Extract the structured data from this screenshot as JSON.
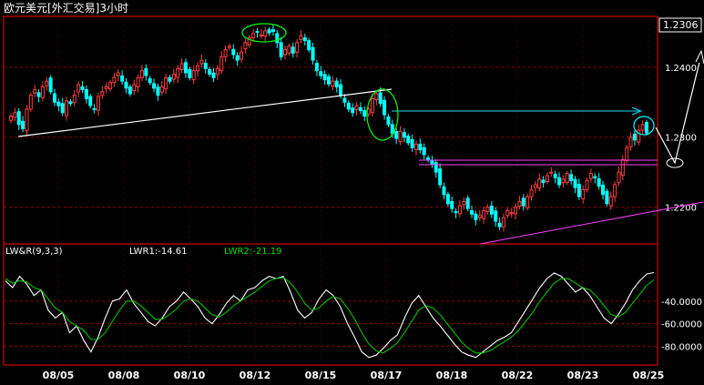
{
  "chart_title": "欧元美元[外汇交易]3小时",
  "price_box": "1.2306",
  "indicator": {
    "name": "LW&R(9,3,3)",
    "lwr1_label": "LWR1:-14.61",
    "lwr2_label": "LWR2:-21.19"
  },
  "colors": {
    "up": "#ff3c3c",
    "down": "#00ffff",
    "lwr1": "#ffffff",
    "lwr2": "#00c000",
    "title": "#ffffff",
    "axis": "#ff0000",
    "grid": "#8b0000",
    "trend_white": "#ffffff",
    "trend_cyan": "#00e0ff",
    "trend_magenta": "#ff40ff",
    "ellipse_green": "#00ff00",
    "ellipse_cyan": "#00ffff"
  },
  "chart_data": [
    {
      "type": "candlestick",
      "ylim": [
        1.215,
        1.247
      ],
      "y_ticks": [
        "1.2400",
        "1.2300",
        "1.2200"
      ],
      "y_tick_values": [
        1.24,
        1.23,
        1.22
      ],
      "x_ticks": [
        "08/05",
        "08/08",
        "08/10",
        "08/12",
        "08/15",
        "08/17",
        "08/18",
        "08/22",
        "08/23",
        "08/25"
      ],
      "close_series": [
        1.233,
        1.2335,
        1.2318,
        1.2312,
        1.234,
        1.236,
        1.2368,
        1.2358,
        1.2372,
        1.238,
        1.2365,
        1.235,
        1.2345,
        1.2335,
        1.2352,
        1.2348,
        1.236,
        1.2375,
        1.2368,
        1.2355,
        1.2345,
        1.234,
        1.2358,
        1.2365,
        1.2372,
        1.2378,
        1.2385,
        1.2392,
        1.238,
        1.237,
        1.2362,
        1.2375,
        1.2385,
        1.2395,
        1.2388,
        1.2378,
        1.237,
        1.236,
        1.2372,
        1.2385,
        1.238,
        1.239,
        1.2398,
        1.2405,
        1.2392,
        1.2385,
        1.2395,
        1.2402,
        1.241,
        1.2398,
        1.239,
        1.2385,
        1.2398,
        1.2415,
        1.2425,
        1.243,
        1.2418,
        1.241,
        1.2422,
        1.2435,
        1.2442,
        1.2448,
        1.245,
        1.2446,
        1.2452,
        1.2449,
        1.2451,
        1.2435,
        1.2415,
        1.2425,
        1.243,
        1.242,
        1.2435,
        1.2445,
        1.2438,
        1.2425,
        1.241,
        1.2395,
        1.2388,
        1.2382,
        1.2376,
        1.238,
        1.2372,
        1.236,
        1.235,
        1.234,
        1.2335,
        1.2345,
        1.2338,
        1.233,
        1.234,
        1.2355,
        1.2362,
        1.2348,
        1.2332,
        1.2318,
        1.2305,
        1.2298,
        1.2308,
        1.23,
        1.2292,
        1.2285,
        1.229,
        1.2282,
        1.2275,
        1.2268,
        1.2262,
        1.225,
        1.2232,
        1.2218,
        1.2205,
        1.2198,
        1.2192,
        1.2202,
        1.2208,
        1.2198,
        1.219,
        1.2182,
        1.2188,
        1.2195,
        1.22,
        1.219,
        1.218,
        1.2172,
        1.2185,
        1.2195,
        1.2192,
        1.22,
        1.2208,
        1.2202,
        1.2215,
        1.2225,
        1.2232,
        1.224,
        1.2235,
        1.2245,
        1.225,
        1.2242,
        1.2232,
        1.224,
        1.2248,
        1.2238,
        1.2228,
        1.2215,
        1.2225,
        1.2238,
        1.2248,
        1.2242,
        1.223,
        1.2218,
        1.2205,
        1.2215,
        1.2232,
        1.225,
        1.2268,
        1.2285,
        1.23,
        1.2296,
        1.231,
        1.2318,
        1.2306
      ]
    },
    {
      "type": "line",
      "ylim": [
        -95,
        -3
      ],
      "y_ticks": [
        "-40.0000",
        "-60.0000",
        "-80.0000"
      ],
      "y_tick_values": [
        -40,
        -60,
        -80
      ],
      "series": [
        {
          "name": "LWR1",
          "values": [
            -22,
            -28,
            -18,
            -25,
            -35,
            -30,
            -48,
            -55,
            -50,
            -68,
            -62,
            -75,
            -85,
            -72,
            -55,
            -40,
            -38,
            -30,
            -42,
            -50,
            -58,
            -62,
            -55,
            -45,
            -40,
            -32,
            -38,
            -45,
            -55,
            -60,
            -52,
            -42,
            -35,
            -40,
            -30,
            -28,
            -22,
            -18,
            -20,
            -18,
            -32,
            -48,
            -55,
            -50,
            -38,
            -30,
            -35,
            -45,
            -60,
            -72,
            -85,
            -90,
            -88,
            -82,
            -75,
            -70,
            -55,
            -42,
            -35,
            -45,
            -55,
            -62,
            -70,
            -78,
            -85,
            -88,
            -90,
            -85,
            -80,
            -75,
            -72,
            -68,
            -58,
            -48,
            -38,
            -28,
            -20,
            -15,
            -18,
            -25,
            -32,
            -28,
            -35,
            -45,
            -55,
            -60,
            -52,
            -42,
            -30,
            -22,
            -16,
            -14.61
          ]
        },
        {
          "name": "LWR2",
          "values": [
            -20,
            -24,
            -22,
            -23,
            -28,
            -30,
            -38,
            -46,
            -50,
            -58,
            -62,
            -66,
            -74,
            -74,
            -68,
            -58,
            -48,
            -40,
            -40,
            -44,
            -50,
            -56,
            -56,
            -52,
            -47,
            -40,
            -38,
            -40,
            -46,
            -52,
            -54,
            -50,
            -44,
            -40,
            -36,
            -32,
            -27,
            -22,
            -20,
            -19,
            -24,
            -32,
            -42,
            -48,
            -46,
            -40,
            -36,
            -38,
            -46,
            -56,
            -68,
            -78,
            -84,
            -86,
            -82,
            -77,
            -68,
            -58,
            -48,
            -44,
            -46,
            -52,
            -60,
            -68,
            -76,
            -82,
            -86,
            -86,
            -84,
            -80,
            -76,
            -72,
            -66,
            -58,
            -50,
            -40,
            -32,
            -24,
            -20,
            -20,
            -24,
            -28,
            -30,
            -36,
            -44,
            -52,
            -54,
            -50,
            -42,
            -34,
            -26,
            -21.19
          ]
        }
      ]
    }
  ]
}
